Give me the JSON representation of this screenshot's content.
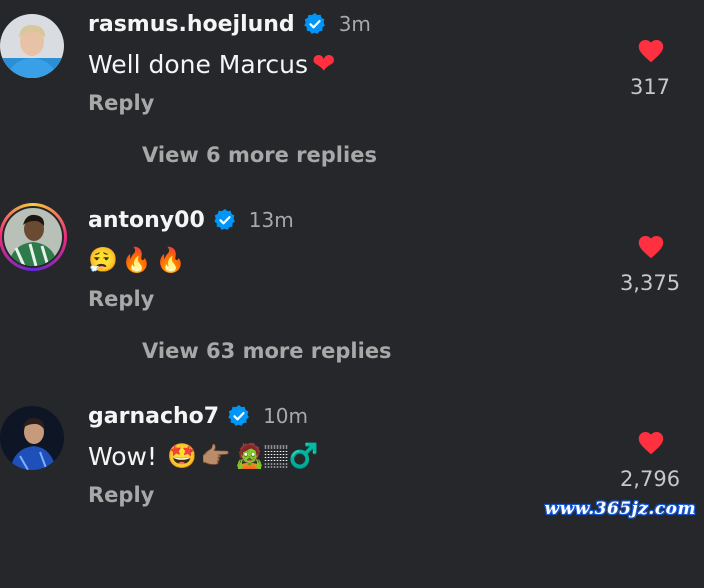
{
  "comments": [
    {
      "username": "rasmus.hoejlund",
      "verified": true,
      "time": "3m",
      "text": "Well done Marcus",
      "emojis": [
        "❤"
      ],
      "reply_label": "Reply",
      "likes": "317",
      "view_more": "View 6 more replies"
    },
    {
      "username": "antony00",
      "verified": true,
      "time": "13m",
      "text": "",
      "emojis": [
        "😮‍💨",
        "🔥",
        "🔥"
      ],
      "reply_label": "Reply",
      "likes": "3,375",
      "view_more": "View 63 more replies"
    },
    {
      "username": "garnacho7",
      "verified": true,
      "time": "10m",
      "text": "Wow!",
      "emojis": [
        "🤩",
        "👉🏽",
        "🧟🏽‍♂️"
      ],
      "reply_label": "Reply",
      "likes": "2,796"
    }
  ],
  "icons": {
    "heart": "heart-icon",
    "verified": "verified-badge-icon"
  },
  "colors": {
    "background": "#25272a",
    "heart": "#ff3040",
    "verified": "#0095f6",
    "secondary_text": "#a8a8a8"
  },
  "watermark": "www.365jz.com"
}
